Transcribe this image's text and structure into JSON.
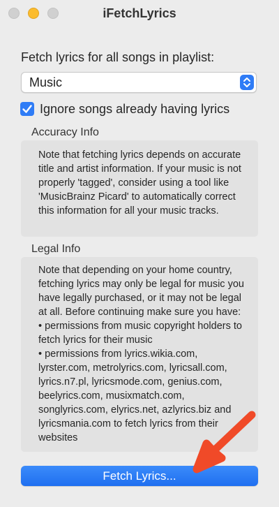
{
  "window": {
    "title": "iFetchLyrics"
  },
  "form": {
    "prompt": "Fetch lyrics for all songs in playlist:",
    "playlist_selected": "Music",
    "ignore_checkbox_label": "Ignore songs already having lyrics",
    "ignore_checked": true
  },
  "accuracy": {
    "title": "Accuracy Info",
    "text": "Note that fetching lyrics depends on accurate title and artist information. If your music is not properly 'tagged', consider using a tool like 'MusicBrainz Picard' to automatically correct this information for all your music tracks."
  },
  "legal": {
    "title": "Legal Info",
    "paragraph": "Note that depending on your home country, fetching lyrics may only be legal for music you have legally purchased, or it may not be legal at all. Before continuing make sure you have:",
    "bullet_1": "• permissions from music copyright holders to fetch lyrics for their music",
    "bullet_2": "• permissions from lyrics.wikia.com, lyrster.com, metrolyrics.com, lyricsall.com, lyrics.n7.pl, lyricsmode.com, genius.com, beelyrics.com, musixmatch.com, songlyrics.com, elyrics.net, azlyrics.biz and lyricsmania.com to fetch lyrics from their websites"
  },
  "actions": {
    "fetch_label": "Fetch Lyrics..."
  },
  "colors": {
    "accent": "#2f7cf6",
    "arrow": "#f04a28",
    "minimize": "#fbbc2e"
  }
}
